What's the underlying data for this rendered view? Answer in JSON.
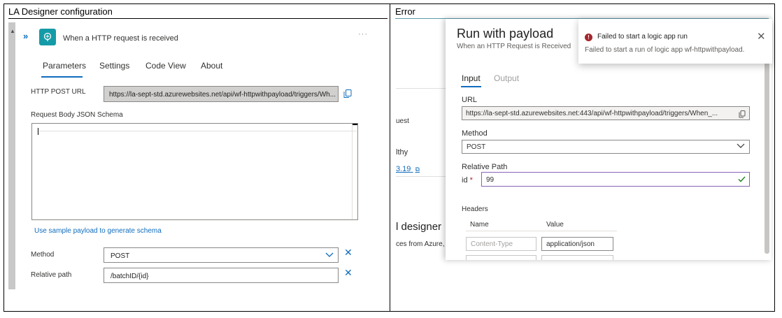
{
  "left": {
    "caption": "LA Designer configuration",
    "trigger_title": "When a HTTP request is received",
    "more_label": "···",
    "tabs": [
      "Parameters",
      "Settings",
      "Code View",
      "About"
    ],
    "http_post_url_label": "HTTP POST URL",
    "http_post_url_value": "https://la-sept-std.azurewebsites.net/api/wf-httpwithpayload/triggers/Wh...",
    "schema_label": "Request Body JSON Schema",
    "sample_payload_link": "Use sample payload to generate schema",
    "method_label": "Method",
    "method_value": "POST",
    "relative_path_label": "Relative path",
    "relative_path_value": "/batchID/{id}"
  },
  "right": {
    "caption": "Error",
    "background": {
      "frag1": "uest",
      "frag2": "lthy",
      "frag3": "3.19",
      "frag4": "l designer",
      "frag5": "ces from Azure,"
    },
    "dialog": {
      "title": "Run with payload",
      "subtitle": "When an HTTP Request is Received",
      "tabs": [
        "Input",
        "Output"
      ],
      "url_label": "URL",
      "url_value": "https://la-sept-std.azurewebsites.net:443/api/wf-httpwithpayload/triggers/When_...",
      "method_label": "Method",
      "method_value": "POST",
      "relative_path_label": "Relative Path",
      "id_label": "id",
      "id_required": "*",
      "id_value": "99",
      "headers_label": "Headers",
      "headers_col_name": "Name",
      "headers_col_value": "Value",
      "header_name_placeholder": "Content-Type",
      "header_value": "application/json"
    },
    "toast": {
      "title": "Failed to start a logic app run",
      "message": "Failed to start a run of logic app wf-httpwithpayload."
    }
  },
  "colors": {
    "accent": "#0f6cbd",
    "trigger_icon": "#159ba8",
    "error": "#a4262c",
    "focus_border": "#8764b8",
    "success_check": "#107c10"
  }
}
